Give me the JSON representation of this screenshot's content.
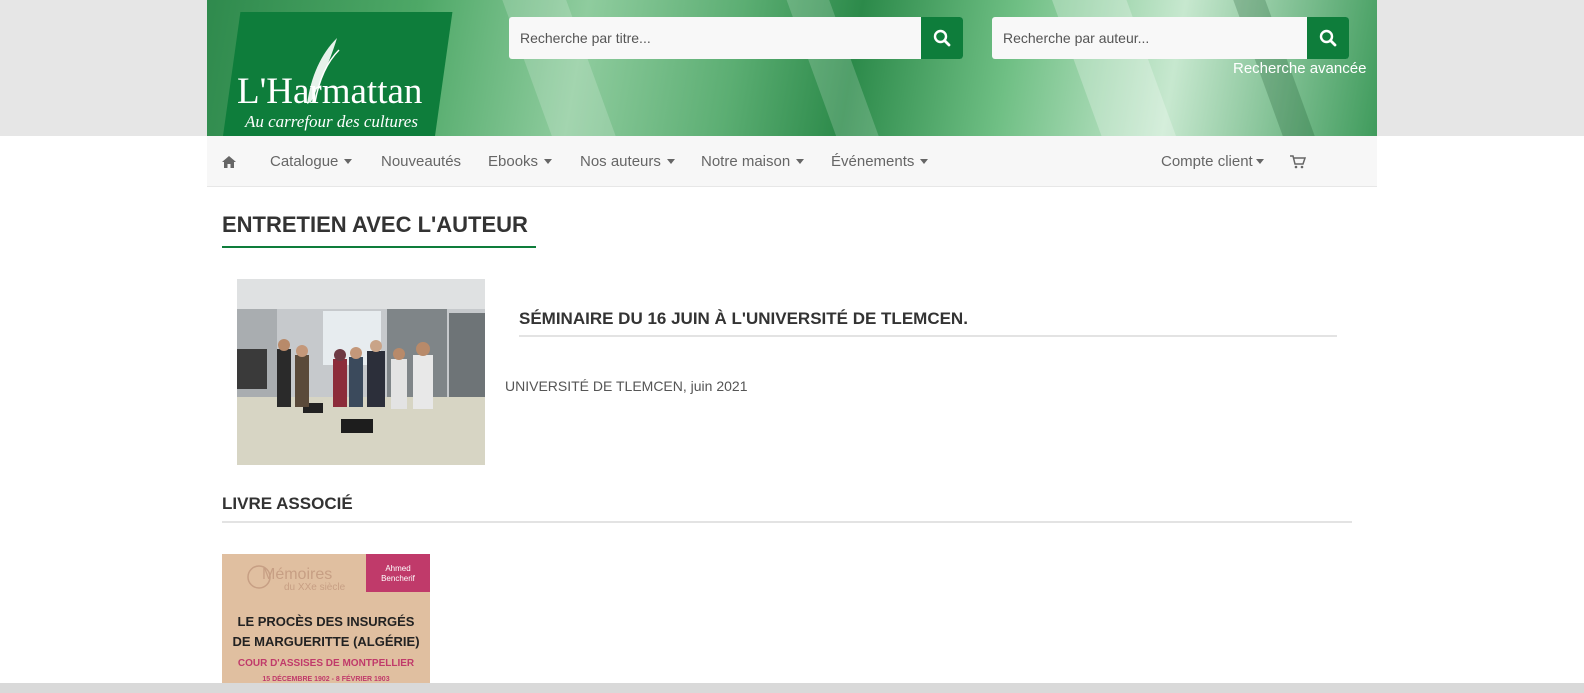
{
  "header": {
    "logo_name": "L'Harmattan",
    "logo_tagline": "Au carrefour des cultures",
    "search_title_placeholder": "Recherche par titre...",
    "search_author_placeholder": "Recherche par auteur...",
    "advanced_search": "Recherche avancée",
    "accent_color": "#0e7d3b"
  },
  "nav": {
    "home_icon": "home-icon",
    "items": [
      {
        "label": "Catalogue",
        "dropdown": true
      },
      {
        "label": "Nouveautés",
        "dropdown": false
      },
      {
        "label": "Ebooks",
        "dropdown": true
      },
      {
        "label": "Nos auteurs",
        "dropdown": true
      },
      {
        "label": "Notre maison",
        "dropdown": true
      },
      {
        "label": "Événements",
        "dropdown": true
      }
    ],
    "account": "Compte client",
    "cart_icon": "cart-icon"
  },
  "main": {
    "page_title": "ENTRETIEN AVEC L'AUTEUR",
    "article": {
      "title": "SÉMINAIRE DU 16 JUIN À L'UNIVERSITÉ DE TLEMCEN.",
      "meta": "UNIVERSITÉ DE TLEMCEN, juin 2021"
    },
    "related_title": "LIVRE ASSOCIÉ",
    "book": {
      "series": "Mémoires",
      "series_sub": "du XXe siècle",
      "author": "Ahmed Bencherif",
      "title_line1": "LE PROCÈS DES INSURGÉS",
      "title_line2": "DE MARGUERITTE (ALGÉRIE)",
      "subtitle": "COUR D'ASSISES DE MONTPELLIER",
      "dates": "15 DÉCEMBRE 1902 - 8 FÉVRIER 1903"
    }
  }
}
